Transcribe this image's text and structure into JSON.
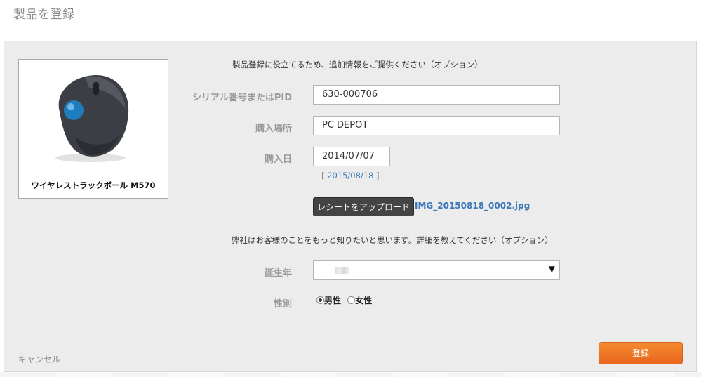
{
  "page": {
    "title": "製品を登録"
  },
  "product": {
    "name": "ワイヤレストラックボール M570"
  },
  "intro_text": "製品登録に役立てるため、追加情報をご提供ください（オプション）",
  "form": {
    "serial": {
      "label": "シリアル番号またはPID",
      "value": "630-000706"
    },
    "place": {
      "label": "購入場所",
      "value": "PC DEPOT"
    },
    "date": {
      "label": "購入日",
      "value": "2014/07/07",
      "link": "2015/08/18"
    },
    "upload": {
      "button_label": "レシートをアップロード",
      "file_name": "IMG_20150818_0002.jpg"
    }
  },
  "profile_text": "弊社はお客様のことをもっと知りたいと思います。詳細を教えてください（オプション）",
  "profile": {
    "birth_year_label": "誕生年",
    "gender_label": "性別",
    "gender_options": [
      "男性",
      "女性"
    ],
    "gender_selected": "男性"
  },
  "actions": {
    "cancel_label": "キャンセル",
    "submit_label": "登録"
  },
  "colors": {
    "accent": "#ef7a26",
    "link": "#3a78b8"
  }
}
